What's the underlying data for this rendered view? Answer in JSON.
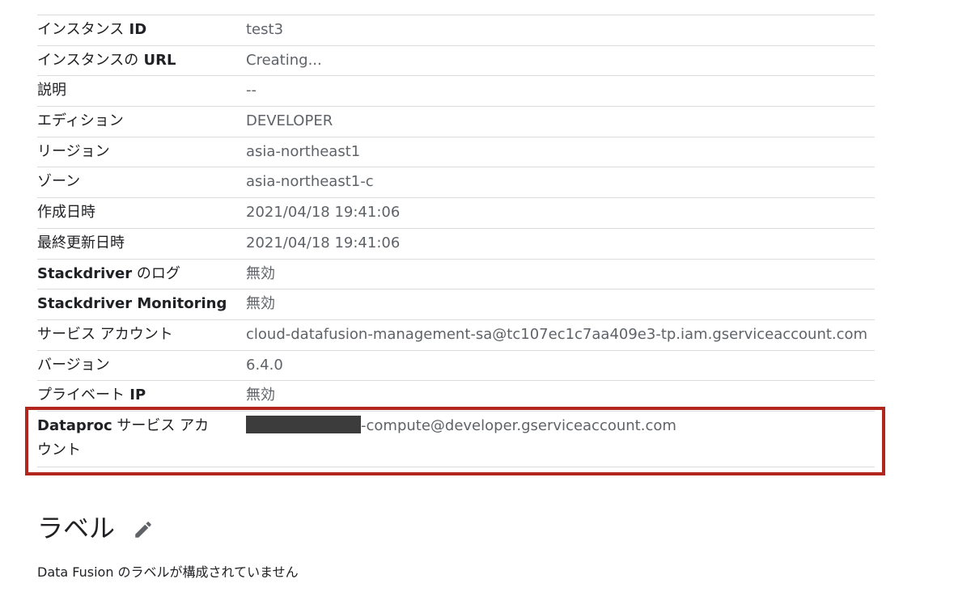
{
  "details": [
    {
      "key_bold": "",
      "key_prefix": "インスタンス",
      "key_bold_suffix": " ID",
      "value": "test3"
    },
    {
      "key_bold": "",
      "key_prefix": "インスタンスの",
      "key_bold_suffix": " URL",
      "value": "Creating..."
    },
    {
      "key_bold": "",
      "key_prefix": "説明",
      "key_bold_suffix": "",
      "value": "--"
    },
    {
      "key_bold": "",
      "key_prefix": "エディション",
      "key_bold_suffix": "",
      "value": "DEVELOPER"
    },
    {
      "key_bold": "",
      "key_prefix": "リージョン",
      "key_bold_suffix": "",
      "value": "asia-northeast1"
    },
    {
      "key_bold": "",
      "key_prefix": "ゾーン",
      "key_bold_suffix": "",
      "value": "asia-northeast1-c"
    },
    {
      "key_bold": "",
      "key_prefix": "作成日時",
      "key_bold_suffix": "",
      "value": "2021/04/18 19:41:06"
    },
    {
      "key_bold": "",
      "key_prefix": "最終更新日時",
      "key_bold_suffix": "",
      "value": "2021/04/18 19:41:06"
    },
    {
      "key_bold": "Stackdriver",
      "key_prefix": " のログ",
      "key_bold_suffix": "",
      "value": "無効"
    },
    {
      "key_bold": "Stackdriver Monitoring",
      "key_prefix": "",
      "key_bold_suffix": "",
      "value": "無効"
    },
    {
      "key_bold": "",
      "key_prefix": "サービス アカウント",
      "key_bold_suffix": "",
      "value": "cloud-datafusion-management-sa@tc107ec1c7aa409e3-tp.iam.gserviceaccount.com"
    },
    {
      "key_bold": "",
      "key_prefix": "バージョン",
      "key_bold_suffix": "",
      "value": "6.4.0"
    },
    {
      "key_bold": "",
      "key_prefix": "プライベート",
      "key_bold_suffix": " IP",
      "value": "無効"
    }
  ],
  "dataproc": {
    "key_bold": "Dataproc",
    "key_rest": " サービス アカウント",
    "value_suffix": "-compute@developer.gserviceaccount.com"
  },
  "labels": {
    "title": "ラベル",
    "empty_message": "Data Fusion のラベルが構成されていません"
  },
  "colors": {
    "highlight_border": "#b3261e",
    "divider": "#dadce0",
    "value_text": "#5f6368"
  }
}
